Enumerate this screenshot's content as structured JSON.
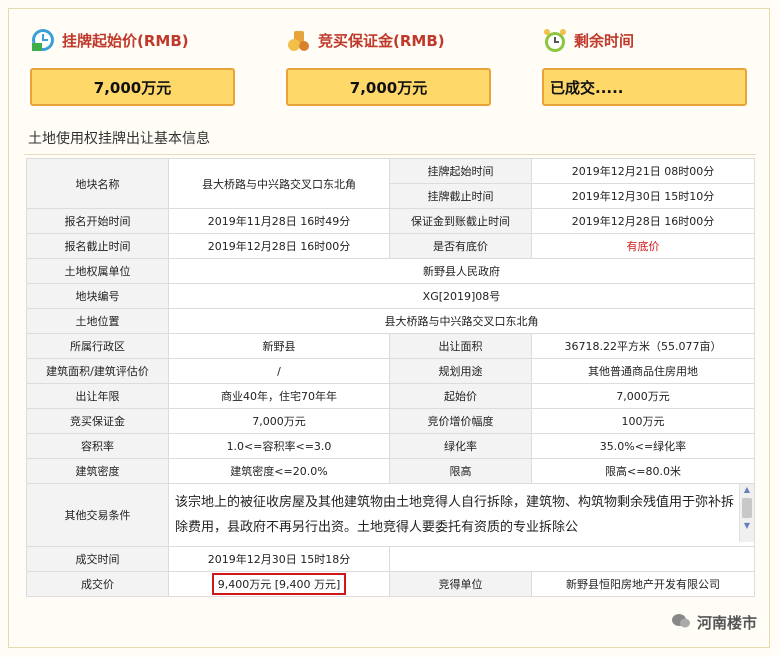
{
  "panels": [
    {
      "title": "挂牌起始价(RMB)",
      "value": "7,000万元",
      "icon": "money-clock-icon"
    },
    {
      "title": "竞买保证金(RMB)",
      "value": "7,000万元",
      "icon": "guarantee-icon"
    },
    {
      "title": "剩余时间",
      "value": "已成交.....",
      "icon": "alarm-clock-icon"
    }
  ],
  "section_title": "土地使用权挂牌出让基本信息",
  "labels": {
    "parcel_name": "地块名称",
    "listing_start": "挂牌起始时间",
    "listing_end": "挂牌截止时间",
    "reg_start": "报名开始时间",
    "deposit_deadline": "保证金到账截止时间",
    "reg_end": "报名截止时间",
    "reserve_price": "是否有底价",
    "owner": "土地权属单位",
    "parcel_no": "地块编号",
    "location": "土地位置",
    "district": "所属行政区",
    "area": "出让面积",
    "building_area": "建筑面积/建筑评估价",
    "use": "规划用途",
    "term": "出让年限",
    "start_price": "起始价",
    "deposit": "竞买保证金",
    "increment": "竞价增价幅度",
    "far": "容积率",
    "green": "绿化率",
    "density": "建筑密度",
    "height": "限高",
    "other": "其他交易条件",
    "deal_time": "成交时间",
    "deal_price": "成交价",
    "winner": "竞得单位"
  },
  "values": {
    "parcel_name": "县大桥路与中兴路交叉口东北角",
    "listing_start": "2019年12月21日 08时00分",
    "listing_end": "2019年12月30日 15时10分",
    "reg_start": "2019年11月28日 16时49分",
    "deposit_deadline": "2019年12月28日 16时00分",
    "reg_end": "2019年12月28日 16时00分",
    "reserve_price": "有底价",
    "owner": "新野县人民政府",
    "parcel_no": "XG[2019]08号",
    "location": "县大桥路与中兴路交叉口东北角",
    "district": "新野县",
    "area": "36718.22平方米（55.077亩）",
    "building_area": "/",
    "use": "其他普通商品住房用地",
    "term": "商业40年，住宅70年年",
    "start_price": "7,000万元",
    "deposit": "7,000万元",
    "increment": "100万元",
    "far": "1.0<=容积率<=3.0",
    "green": "35.0%<=绿化率",
    "density": "建筑密度<=20.0%",
    "height": "限高<=80.0米",
    "other": "该宗地上的被征收房屋及其他建筑物由土地竞得人自行拆除，建筑物、构筑物剩余残值用于弥补拆除费用，县政府不再另行出资。土地竞得人要委托有资质的专业拆除公",
    "deal_time": "2019年12月30日 15时18分",
    "deal_price": "9,400万元 [9,400 万元]",
    "winner": "新野县恒阳房地产开发有限公司"
  },
  "colors": {
    "accent_red": "#c0392b",
    "box_fill": "#ffd86a",
    "box_border": "#e8a33a"
  },
  "watermark": "河南楼市"
}
